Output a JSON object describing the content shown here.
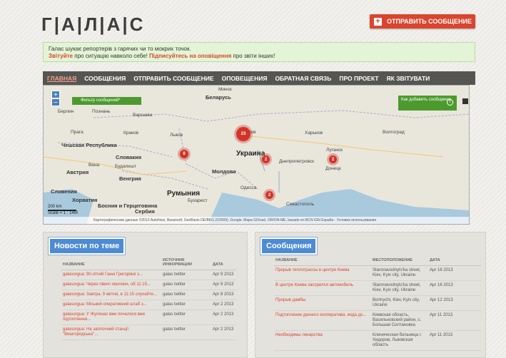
{
  "header": {
    "logo": "Г|А|Л|А|С",
    "send_button": "ОТПРАВИТЬ СООБЩЕНИЕ"
  },
  "info": {
    "line1": "Галас шукає репортерів з гарячих чи то мокрих точок.",
    "line2_a": "Звітуйте",
    "line2_b": " про ситуацію навколо себе! ",
    "line2_c": "Підписуйтесь на оповіщення",
    "line2_d": " про звіти інших!"
  },
  "nav": {
    "items": [
      {
        "label": "ГЛАВНАЯ",
        "active": true
      },
      {
        "label": "СООБЩЕНИЯ",
        "active": false
      },
      {
        "label": "ОТПРАВИТЬ СООБЩЕНИЕ",
        "active": false
      },
      {
        "label": "ОПОВЕЩЕНИЯ",
        "active": false
      },
      {
        "label": "ОБРАТНАЯ СВЯЗЬ",
        "active": false
      },
      {
        "label": "ПРО ПРОЕКТ",
        "active": false
      },
      {
        "label": "ЯК ЗВІТУВАТИ",
        "active": false
      }
    ]
  },
  "map": {
    "filter_label": "Фильтр сообщений*",
    "howto_label": "Как добавить сообщение",
    "clusters": [
      "23",
      "8",
      "2",
      "2",
      "2"
    ],
    "labels": {
      "belarus": "Беларусь",
      "ukraine": "Украина",
      "romania": "Румыния",
      "moldova": "Молдова",
      "slovakia": "Словакия",
      "czech": "Чешская Республика",
      "austria": "Австрия",
      "hungary": "Венгрия",
      "minsk": "Минск",
      "kyiv": "Киев",
      "kharkiv": "Харьков",
      "lviv": "Львов",
      "odessa": "Одесса",
      "berlin": "Берлин",
      "warsaw": "Варшава",
      "poznan": "Познань",
      "prague": "Прага",
      "krakow": "Краков",
      "vienna": "Вена",
      "budapest": "Будапешт",
      "bucharest": "Бухарест",
      "dnepr": "Днепропетровск",
      "donetsk": "Донецк",
      "lugansk": "Луганск",
      "volgograd": "Волгоград",
      "sevastopol": "Севастополь",
      "serbia": "Сербия",
      "bosnia": "Босния и Герцеговина",
      "croatia": "Хорватия",
      "slovenia": "Словения"
    },
    "footer": "Картографические данные ©2013 AutoNavi, Basarsoft, GeoBasis-DE/BKG (©2009), Google, Mapa GISrael, ORION-ME, basado en BCN IGN España - Условия использования",
    "scale_label": "Scale = 1 : 14M",
    "scale_text": "200 km"
  },
  "news": {
    "title": "Новости по теме",
    "headers": [
      "НАЗВАНИЕ",
      "ИСТОЧНИК ИНФОРМАЦИИ",
      "ДАТА"
    ],
    "rows": [
      [
        "galasorgua: 90-літній Ганні Григорівні з...",
        "galas twitter",
        "Apr 9 2013"
      ],
      [
        "galasorgua: Через північ хвилини, об 11:15...",
        "galas twitter",
        "Apr 9 2013"
      ],
      [
        "galasorgua: Завтра, 9 квітня, в 11:15 слухайте...",
        "galas twitter",
        "Apr 8 2013"
      ],
      [
        "galasorgua: Міський оперативний штаб з...",
        "galas twitter",
        "Apr 2 2013"
      ],
      [
        "galasorgua: У Жулянах вже почалося вже підтоплення...",
        "galas twitter",
        "Apr 2 2013"
      ],
      [
        "galasorgua: На заплочний станції \"Вишгородська\"...",
        "galas twitter",
        "Apr 2 2013"
      ]
    ]
  },
  "reports": {
    "title": "Сообщения",
    "headers": [
      "НАЗВАНИЕ",
      "МЕСТОПОЛОЖЕНИЕ",
      "ДАТА"
    ],
    "rows": [
      [
        "Прорыв теплотрассы в центре Киева",
        "Staronavodnyts'ka street, Kiev, Kyiv city, Ukraine",
        "Apr 16 2013"
      ],
      [
        "В центре Киева засорился автомобиль",
        "Staronavodnyts'ka street, Kiev, Kyiv city, Ukraine",
        "Apr 16 2013"
      ],
      [
        "Прорыв дамбы",
        "Bortnychi, Kiev, Kyiv city, Ukraine",
        "Apr 12 2013"
      ],
      [
        "Подтопление дачного кооператива, вода до...",
        "Киевская область, Васильковский район, с. Большая Солтановка",
        "Apr 11 2013"
      ],
      [
        "Необходимы лекарства",
        "Клиническая больница г. Хидоров, Львовская область",
        "Apr 11 2013"
      ]
    ]
  }
}
